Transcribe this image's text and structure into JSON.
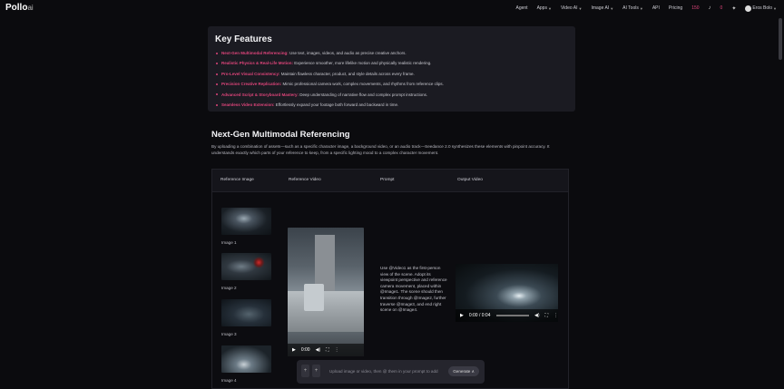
{
  "header": {
    "logo": "Pollo",
    "logo_suffix": "ai",
    "nav": [
      {
        "label": "Agent",
        "chevron": false
      },
      {
        "label": "Apps",
        "chevron": true
      },
      {
        "label": "Video AI",
        "chevron": true
      },
      {
        "label": "Image AI",
        "chevron": true
      },
      {
        "label": "AI Tools",
        "chevron": true
      },
      {
        "label": "API",
        "chevron": false
      },
      {
        "label": "Pricing",
        "chevron": false
      }
    ],
    "credits": "150",
    "credits2": "0",
    "user": "Eros Bolo",
    "accent": "#e0457b"
  },
  "features": {
    "title": "Key Features",
    "items": [
      {
        "highlight": "Next-Gen Multimodal Referencing:",
        "text": " Use text, images, videos, and audio as precise creative anchors."
      },
      {
        "highlight": "Realistic Physics & Real-Life Motion:",
        "text": " Experience smoother, more lifelike motion and physically realistic rendering."
      },
      {
        "highlight": "Pro-Level Visual Consistency:",
        "text": " Maintain flawless character, product, and style details across every frame."
      },
      {
        "highlight": "Precision Creative Replication:",
        "text": " Mimic professional camera work, complex movements, and rhythms from reference clips."
      },
      {
        "highlight": "Advanced Script & Storyboard Mastery:",
        "text": " Deep understanding of narrative flow and complex prompt instructions."
      },
      {
        "highlight": "Seamless Video Extension:",
        "text": " Effortlessly expand your footage both forward and backward in time."
      }
    ]
  },
  "section": {
    "title": "Next-Gen Multimodal Referencing",
    "description": "By uploading a combination of assets—such as a specific character image, a background video, or an audio track—Seedance 2.0 synthesizes these elements with pinpoint accuracy. It understands exactly which parts of your reference to keep, from a specific lighting mood to a complex character movement."
  },
  "table": {
    "headers": [
      "Reference Image",
      "Reference Video",
      "Prompt",
      "Output Video"
    ],
    "images": [
      "Image 1",
      "Image 2",
      "Image 3",
      "Image 4"
    ],
    "ref_time": "0:00",
    "prompt": "Use @Video1 as the first-person view of the scene. Adopt its viewpoint perspective and reference camera movement, placed within @Image1. The scene should then transition through @Image2, further traverse @Image3, and end right scene on @Image4.",
    "out_time": "0:00 / 0:04"
  },
  "chat": {
    "placeholder": "Upload image or video, then @ them in your prompt to add",
    "button": "Generate ∧"
  }
}
